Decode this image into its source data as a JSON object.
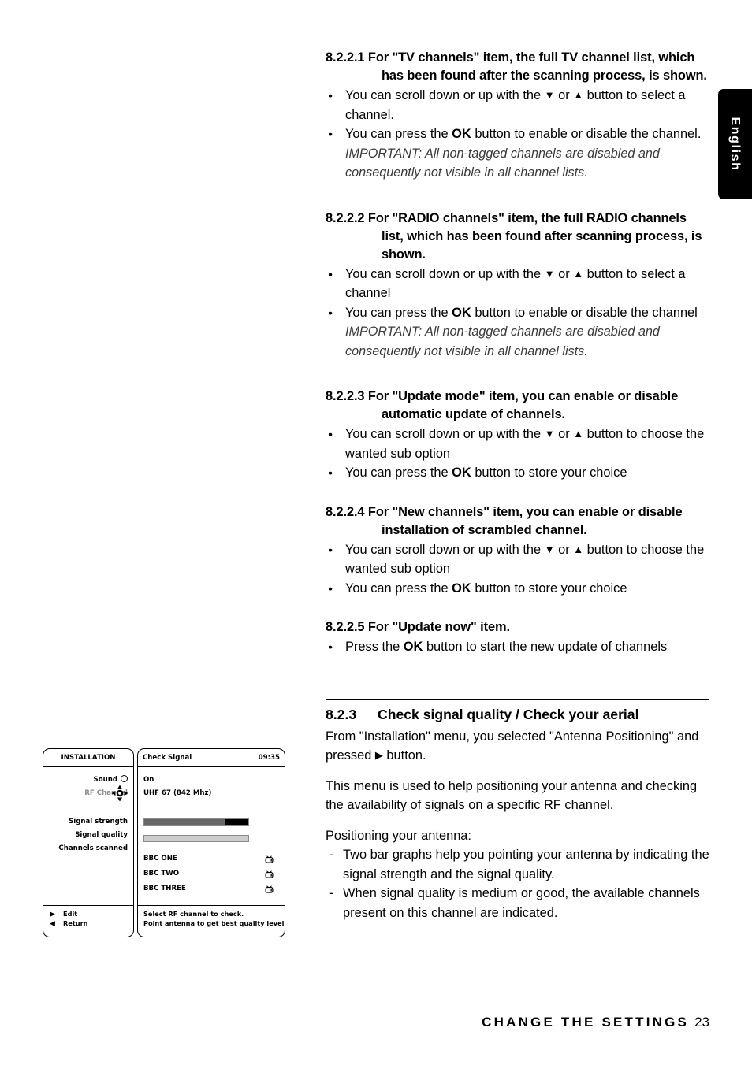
{
  "language_tab": {
    "label": "English"
  },
  "sections": [
    {
      "id": "8.2.2.1",
      "number": "8.2.2.1",
      "heading": "For \"TV channels\" item, the full TV channel list, which has been found after the scanning process, is shown.",
      "bullets": [
        "You can scroll down or up with the ▼ or ▲ button to select a channel.",
        "You can press the OK button to enable or disable the channel."
      ],
      "note": "IMPORTANT: All non-tagged channels are disabled and consequently not visible in all channel lists."
    },
    {
      "id": "8.2.2.2",
      "number": "8.2.2.2",
      "heading": "For \"RADIO channels\" item, the full RADIO channels list, which has been found after scanning process, is shown.",
      "bullets": [
        "You can scroll down or up with the ▼ or ▲ button to select a channel",
        "You can press the OK button to enable or disable the channel"
      ],
      "note": "IMPORTANT: All non-tagged channels are disabled and consequently not visible in all channel lists."
    },
    {
      "id": "8.2.2.3",
      "number": "8.2.2.3",
      "heading": "For \"Update mode\" item, you can enable or disable automatic update of channels.",
      "bullets": [
        "You can scroll down or up with the ▼ or ▲ button to choose the wanted sub option",
        "You can press the OK button to store your choice"
      ]
    },
    {
      "id": "8.2.2.4",
      "number": "8.2.2.4",
      "heading": "For \"New channels\" item, you can enable or disable installation of scrambled channel.",
      "bullets": [
        "You can scroll down or up with the ▼ or ▲ button to choose the wanted sub option",
        "You can press the OK button to store your choice"
      ]
    },
    {
      "id": "8.2.2.5",
      "number": "8.2.2.5",
      "heading": "For \"Update now\" item.",
      "bullets": [
        "Press the OK button to start the new update of channels"
      ]
    }
  ],
  "section_823": {
    "number": "8.2.3",
    "title": "Check signal quality / Check your aerial",
    "intro": "From \"Installation\" menu, you selected \"Antenna Positioning\" and pressed ▶ button.",
    "para2": "This menu is used to help  positioning your antenna and checking the availability of signals on a specific  RF channel.",
    "para3": "Positioning your antenna:",
    "dashes": [
      "Two bar graphs help you pointing your antenna by indicating the signal strength and the signal quality.",
      "When signal quality is medium or good, the available channels present on this channel are indicated."
    ]
  },
  "tv_menu": {
    "left": {
      "title": "INSTALLATION",
      "items": [
        {
          "label": "Sound",
          "icon": "circle-icon",
          "dim": false
        },
        {
          "label": "RF Channel",
          "icon": "navpad-icon",
          "dim": true
        },
        {
          "label": "Signal strength",
          "icon": "",
          "dim": false
        },
        {
          "label": "Signal quality",
          "icon": "",
          "dim": false
        },
        {
          "label": "Channels scanned",
          "icon": "",
          "dim": false
        }
      ],
      "footer": [
        {
          "glyph": "▶",
          "label": "Edit"
        },
        {
          "glyph": "◀",
          "label": "Return"
        }
      ]
    },
    "right": {
      "title": "Check Signal",
      "clock": "09:35",
      "sound_value": "On",
      "rf_value": "UHF 67 (842 Mhz)",
      "bars": [
        {
          "name": "signal-strength-bar",
          "percent": 78,
          "fill_color": "#666666",
          "rest_color": "#000000"
        },
        {
          "name": "signal-quality-bar",
          "percent": 100,
          "fill_color": "#cccccc",
          "rest_color": "#ffffff"
        }
      ],
      "channels": [
        {
          "name": "BBC ONE",
          "icon": "tv-icon"
        },
        {
          "name": "BBC TWO",
          "icon": "tv-icon"
        },
        {
          "name": "BBC THREE",
          "icon": "tv-icon"
        }
      ],
      "footer": [
        "Select RF channel to check.",
        "Point antenna to get best quality level"
      ]
    }
  },
  "footer": {
    "title": "CHANGE THE SETTINGS",
    "page": "23"
  }
}
